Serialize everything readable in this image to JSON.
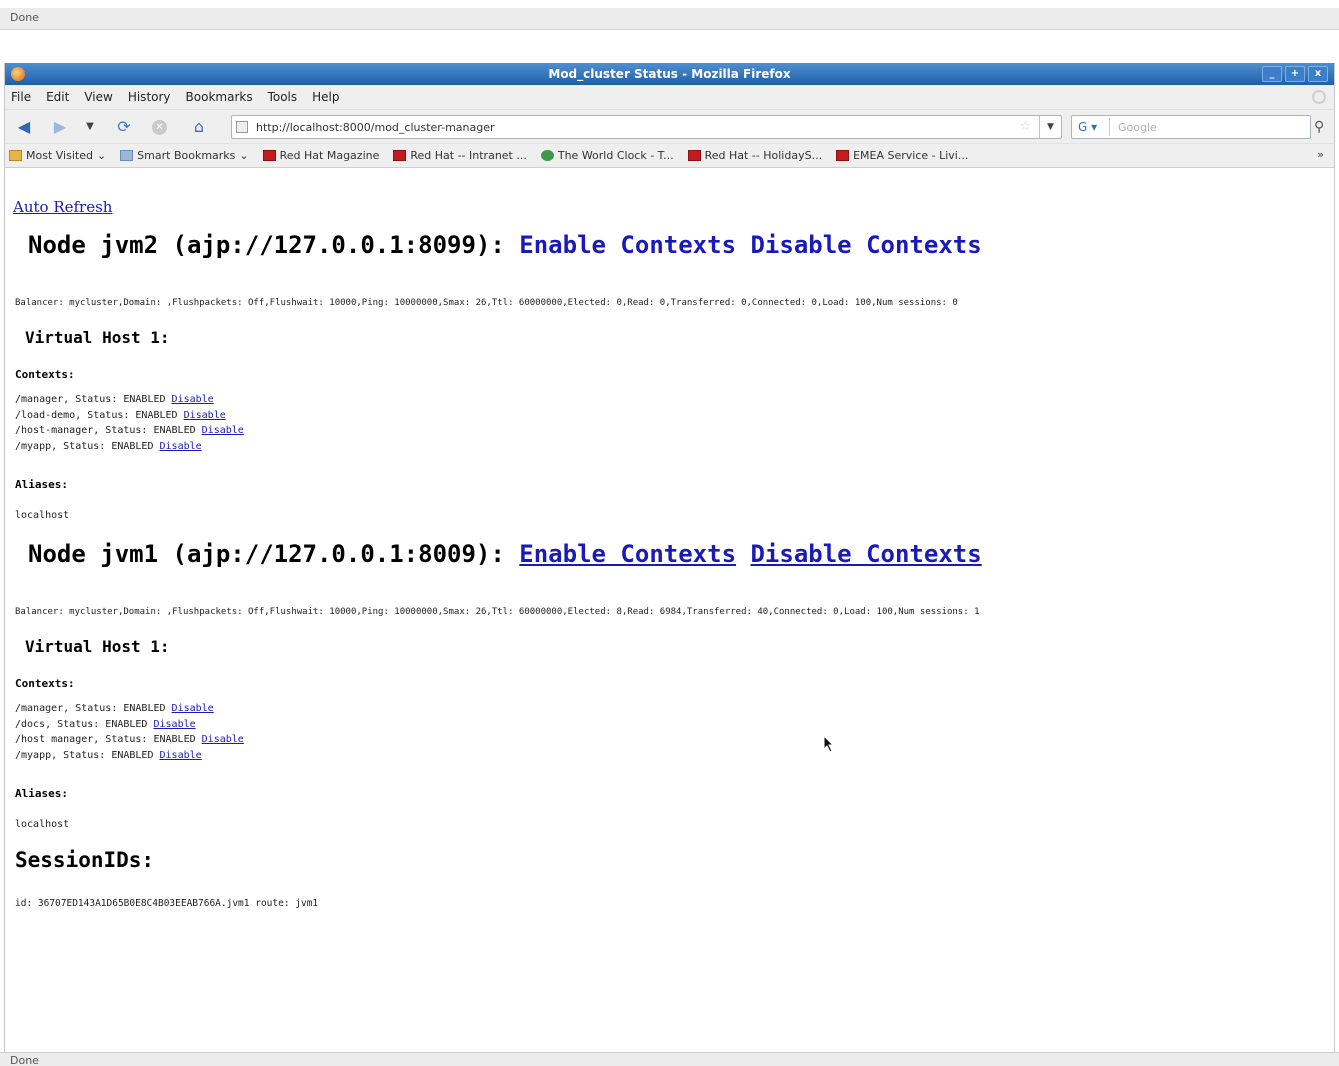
{
  "top_status": {
    "text": "Done"
  },
  "window": {
    "title": "Mod_cluster Status - Mozilla Firefox",
    "controls": [
      "_",
      "+",
      "x"
    ]
  },
  "menu": [
    "File",
    "Edit",
    "View",
    "History",
    "Bookmarks",
    "Tools",
    "Help"
  ],
  "toolbar": {
    "url": "http://localhost:8000/mod_cluster-manager",
    "search_placeholder": "Google"
  },
  "bookmarks": [
    {
      "label": "Most Visited",
      "icon": "folder-star",
      "dropdown": true
    },
    {
      "label": "Smart Bookmarks",
      "icon": "folder",
      "dropdown": true
    },
    {
      "label": "Red Hat Magazine",
      "icon": "redhat"
    },
    {
      "label": "Red Hat -- Intranet ...",
      "icon": "redhat"
    },
    {
      "label": "The World Clock - T...",
      "icon": "clock"
    },
    {
      "label": "Red Hat -- HolidayS...",
      "icon": "redhat"
    },
    {
      "label": "EMEA Service - Livi...",
      "icon": "redhat"
    }
  ],
  "page": {
    "auto_refresh": "Auto Refresh",
    "nodes": [
      {
        "title": "Node jvm2 (ajp://127.0.0.1:8099):",
        "enable": "Enable Contexts",
        "disable": "Disable Contexts",
        "info": "Balancer: mycluster,Domain: ,Flushpackets: Off,Flushwait: 10000,Ping: 10000000,Smax: 26,Ttl: 60000000,Elected: 0,Read: 0,Transferred: 0,Connected: 0,Load: 100,Num sessions: 0",
        "vhost": "Virtual Host 1:",
        "contexts_label": "Contexts:",
        "contexts": [
          {
            "text": "/manager, Status: ENABLED",
            "link": "Disable"
          },
          {
            "text": "/load-demo, Status: ENABLED",
            "link": "Disable"
          },
          {
            "text": "/host-manager, Status: ENABLED",
            "link": "Disable"
          },
          {
            "text": "/myapp, Status: ENABLED",
            "link": "Disable"
          }
        ],
        "aliases_label": "Aliases:",
        "alias": "localhost"
      },
      {
        "title": "Node jvm1 (ajp://127.0.0.1:8009):",
        "enable": "Enable Contexts",
        "disable": "Disable Contexts",
        "info": "Balancer: mycluster,Domain: ,Flushpackets: Off,Flushwait: 10000,Ping: 10000000,Smax: 26,Ttl: 60000000,Elected: 8,Read: 6984,Transferred: 40,Connected: 0,Load: 100,Num sessions: 1",
        "vhost": "Virtual Host 1:",
        "contexts_label": "Contexts:",
        "contexts": [
          {
            "text": "/manager, Status: ENABLED",
            "link": "Disable"
          },
          {
            "text": "/docs, Status: ENABLED",
            "link": "Disable"
          },
          {
            "text": "/host manager, Status: ENABLED",
            "link": "Disable"
          },
          {
            "text": "/myapp, Status: ENABLED",
            "link": "Disable"
          }
        ],
        "aliases_label": "Aliases:",
        "alias": "localhost"
      }
    ],
    "sessions_heading": "SessionIDs:",
    "session_line": "id: 36707ED143A1D65B0E8C4B03EEAB766A.jvm1 route: jvm1"
  },
  "bottom_status": {
    "text": "Done"
  }
}
